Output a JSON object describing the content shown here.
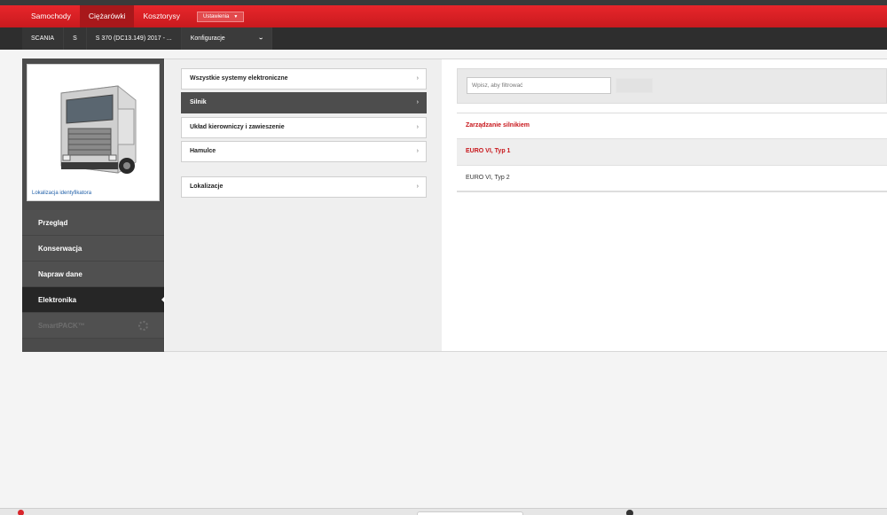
{
  "header": {
    "tabs": [
      {
        "label": "Samochody"
      },
      {
        "label": "Ciężarówki"
      },
      {
        "label": "Kosztorysy"
      }
    ],
    "settings_label": "Ustawienia"
  },
  "vehicle_bar": {
    "make": "SCANIA",
    "series": "S",
    "model": "S 370 (DC13.149) 2017 - ...",
    "config_label": "Konfiguracje"
  },
  "vehicle_panel": {
    "identifier_link": "Lokalizacja identyfikatora",
    "menu": [
      {
        "label": "Przegląd"
      },
      {
        "label": "Konserwacja"
      },
      {
        "label": "Napraw dane"
      },
      {
        "label": "Elektronika"
      },
      {
        "label": "SmartPACK™"
      }
    ]
  },
  "systems": {
    "items": [
      {
        "label": "Wszystkie systemy elektroniczne"
      },
      {
        "label": "Silnik"
      },
      {
        "label": "Układ kierowniczy i zawieszenie"
      },
      {
        "label": "Hamulce"
      },
      {
        "label": "Lokalizacje"
      }
    ]
  },
  "filter": {
    "placeholder": "Wpisz, aby filtrować"
  },
  "results": {
    "heading": "Zarządzanie silnikiem",
    "items": [
      {
        "label": "EURO VI, Typ 1"
      },
      {
        "label": "EURO VI, Typ 2"
      }
    ]
  },
  "colors": {
    "brand_red": "#d21f24",
    "dark_bar": "#2e2e2e",
    "highlight_text": "#c8161b"
  }
}
